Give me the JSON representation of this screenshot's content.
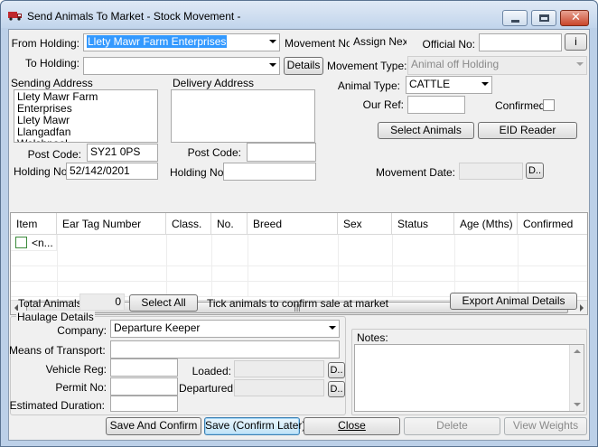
{
  "window": {
    "title": "Send Animals To Market - Stock Movement -",
    "minimize": "minimize-icon",
    "maximize": "maximize-icon",
    "close": "close-icon"
  },
  "header": {
    "from_holding_label": "From Holding:",
    "from_holding_value": "Llety Mawr Farm Enterprises",
    "to_holding_label": "To Holding:",
    "to_holding_value": "",
    "details_button": "Details",
    "movement_no_label": "Movement No:",
    "movement_no_value": "Assign Next",
    "official_no_label": "Official No:",
    "official_no_value": "",
    "info_button": "i",
    "movement_type_label": "Movement Type:",
    "movement_type_value": "Animal off Holding",
    "animal_type_label": "Animal Type:",
    "animal_type_value": "CATTLE",
    "our_ref_label": "Our Ref:",
    "our_ref_value": "",
    "confirmed_label": "Confirmed:",
    "select_animals_button": "Select Animals",
    "eid_reader_button": "EID Reader",
    "movement_date_label": "Movement Date:",
    "movement_date_value": "",
    "date_button": "D.."
  },
  "sending": {
    "title": "Sending Address",
    "address": "Llety Mawr Farm Enterprises\nLlety Mawr\nLlangadfan\nWelshpool",
    "post_code_label": "Post Code:",
    "post_code_value": "SY21 0PS",
    "holding_no_label": "Holding No:",
    "holding_no_value": "52/142/0201"
  },
  "delivery": {
    "title": "Delivery Address",
    "address": "",
    "post_code_label": "Post Code:",
    "post_code_value": "",
    "holding_no_label": "Holding No:",
    "holding_no_value": ""
  },
  "grid": {
    "columns": [
      "Item",
      "Ear Tag Number",
      "Class.",
      "No.",
      "Breed",
      "Sex",
      "Status",
      "Age (Mths)",
      "Confirmed"
    ],
    "rows": [
      {
        "item": "<n..."
      }
    ],
    "scroll_grip": "|||"
  },
  "totals": {
    "total_animals_label": "Total Animals:",
    "total_animals_value": "0",
    "select_all_button": "Select All",
    "hint": "Tick animals to confirm sale at market",
    "export_button": "Export Animal Details"
  },
  "haulage": {
    "title": "Haulage Details",
    "company_label": "Company:",
    "company_value": "Departure Keeper",
    "means_label": "Means of Transport:",
    "means_value": "",
    "vehicle_label": "Vehicle Reg:",
    "vehicle_value": "",
    "permit_label": "Permit No:",
    "permit_value": "",
    "duration_label": "Estimated Duration:",
    "duration_value": "",
    "loaded_label": "Loaded:",
    "loaded_value": "",
    "departured_label": "Departured:",
    "departured_value": "",
    "date_button": "D.."
  },
  "notes": {
    "label": "Notes:",
    "value": ""
  },
  "footer": {
    "save_confirm": "Save And Confirm",
    "save_later": "Save (Confirm Later)",
    "close": "Close",
    "delete": "Delete",
    "view_weights": "View Weights"
  },
  "colors": {
    "selection": "#3399ff",
    "titlebar": "#c2d5ec",
    "close_button": "#c9452a"
  }
}
